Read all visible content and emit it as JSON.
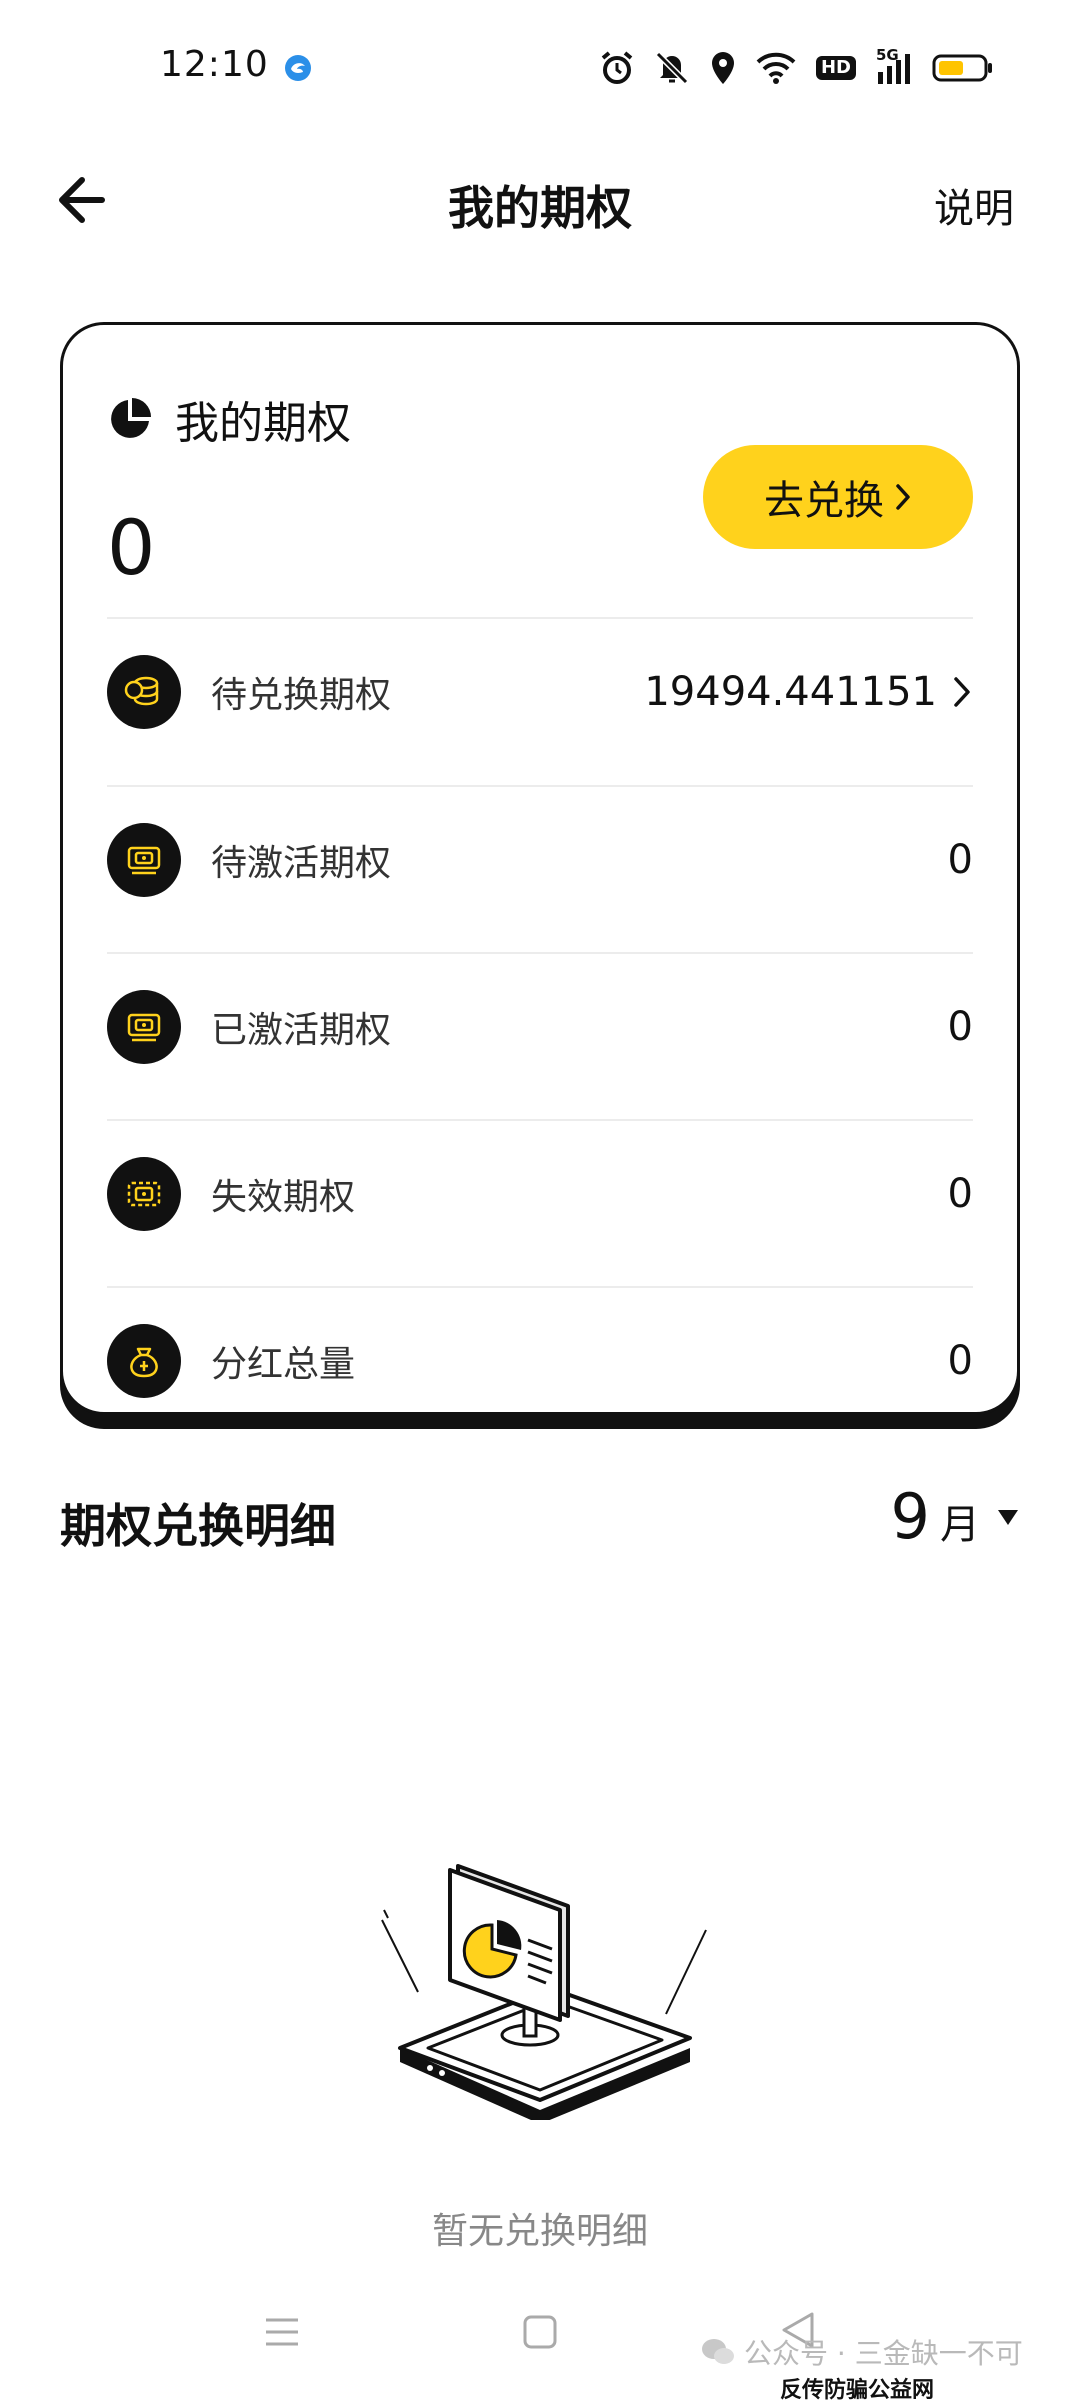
{
  "status_bar": {
    "time": "12:10",
    "signal_label": "5G",
    "hd_label": "HD",
    "icons": [
      "browser-icon",
      "alarm-icon",
      "mute-icon",
      "location-icon",
      "wifi-icon",
      "hd-icon",
      "signal-icon",
      "battery-icon"
    ]
  },
  "header": {
    "title": "我的期权",
    "help_label": "说明",
    "back_icon": "arrow-left-icon"
  },
  "card": {
    "title": "我的期权",
    "title_icon": "pie-chart-icon",
    "total_value": "0",
    "exchange_button": "去兑换",
    "items": [
      {
        "label": "待兑换期权",
        "value": "19494.441151",
        "icon": "coins-icon",
        "has_chevron": true
      },
      {
        "label": "待激活期权",
        "value": "0",
        "icon": "ticket-icon"
      },
      {
        "label": "已激活期权",
        "value": "0",
        "icon": "ticket-active-icon"
      },
      {
        "label": "失效期权",
        "value": "0",
        "icon": "ticket-expired-icon"
      },
      {
        "label": "分红总量",
        "value": "0",
        "icon": "money-bag-icon"
      }
    ]
  },
  "details": {
    "title": "期权兑换明细",
    "month_number": "9",
    "month_suffix": "月",
    "empty_text": "暂无兑换明细"
  },
  "colors": {
    "accent_yellow": "#ffd21c",
    "text_primary": "#111111",
    "text_secondary": "#333333",
    "text_muted": "#888888",
    "divider": "#ececec"
  },
  "watermark": {
    "main": "公众号 · 三金缺一不可",
    "site": "反传防骗公益网 www.wazi.cc"
  }
}
